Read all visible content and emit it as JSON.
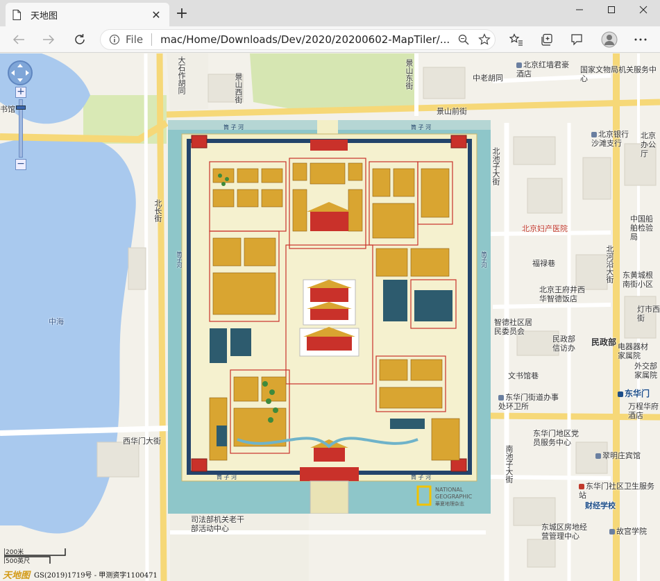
{
  "browser": {
    "tab_title": "天地图",
    "new_tab": "+",
    "address_scheme": "File",
    "address_url": "mac/Home/Downloads/Dev/2020/20200602-MapTiler/..."
  },
  "map": {
    "labels": {
      "book_hall": "书馆",
      "dashizuo": "大石作胡同",
      "jingshan_west": "景山西街",
      "jingshan_east": "景山东街",
      "jingshan_front": "景山前街",
      "zhonglao": "中老胡同",
      "hongqiang": "北京红墙君豪酒店",
      "wenwu": "国家文物局机关服务中心",
      "bank": "北京银行沙滩支行",
      "office_right": "北京办公厅",
      "beichizi": "北池子大街",
      "nanchang": "北长街",
      "maternity": "北京妇产医院",
      "chuanbo": "中国船舶检验局",
      "fulu": "福禄巷",
      "heyan": "北河沿大街",
      "dongcheng": "东黄城根南街小区",
      "zhiyin": "北京王府井西华智德饭店",
      "dengshi": "灯市西街",
      "xihua_committee": "智德社区居民委员会",
      "minzheng_office": "民政部信访办",
      "minzhengbu": "民政部",
      "dianqi": "电器器材家属院",
      "waijiao": "外交部家属院",
      "zhonghai": "中海",
      "wenshuguan": "文书馆巷",
      "donghuamen_office": "东华门街道办事处环卫所",
      "donghuamen": "东华门",
      "wanfu": "万程华府酒店",
      "xihuamen": "西华门大街",
      "donghuamen_center": "东华门地区党员服务中心",
      "nanchizi": "南池子大街",
      "cuiming": "翠明庄宾馆",
      "donghua_clinic": "东华门社区卫生服务站",
      "caijing": "财经学校",
      "sifa": "司法部机关老干部活动中心",
      "fangdi": "东城区房地经营管理中心",
      "gugong_school": "故宫学院"
    },
    "palace": {
      "moat_top_left": "筒 子 河",
      "moat_top_right": "筒 子 河",
      "moat_left": "筒子河",
      "moat_right": "筒子河",
      "moat_bottom_left": "筒 子 河",
      "moat_bottom_right": "筒 子 河",
      "ng_line1": "NATIONAL",
      "ng_line2": "GEOGRAPHIC",
      "ng_line3": "華夏地理杂志"
    },
    "scale": {
      "top": "200米",
      "bottom": "500英尺"
    },
    "copyright": {
      "logo": "天地图",
      "text": "GS(2019)1719号 - 甲测资字1100471"
    }
  },
  "colors": {
    "water": "#a9c9ee",
    "park": "#d6e6b2",
    "road_major": "#f6d878",
    "road": "#ffffff",
    "palace_bg": "#f3efc7",
    "moat": "#8ec6c9",
    "palace_wall": "#c9312a"
  }
}
